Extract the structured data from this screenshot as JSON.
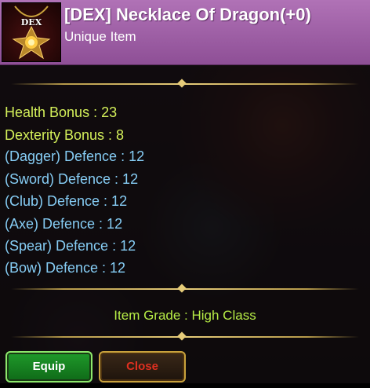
{
  "item": {
    "icon_tag": "DEX",
    "icon_name": "dragon-necklace-icon",
    "title": "[DEX] Necklace Of Dragon(+0)",
    "rarity": "Unique Item",
    "title_color": "#ffffff",
    "header_color": "#a062a8"
  },
  "stats": {
    "health_bonus": "Health Bonus : 23",
    "dexterity_bonus": "Dexterity Bonus : 8",
    "dagger_defence": "(Dagger) Defence : 12",
    "sword_defence": "(Sword) Defence : 12",
    "club_defence": "(Club) Defence : 12",
    "axe_defence": "(Axe) Defence : 12",
    "spear_defence": "(Spear) Defence : 12",
    "bow_defence": "(Bow) Defence : 12"
  },
  "grade": "Item Grade : High Class",
  "buttons": {
    "equip": "Equip",
    "close": "Close"
  },
  "colors": {
    "primary_stat": "#d4f05a",
    "defence_stat": "#86cdf5",
    "grade": "#b6ec46",
    "equip_button": "#1f9a2a",
    "close_text": "#e03020"
  }
}
